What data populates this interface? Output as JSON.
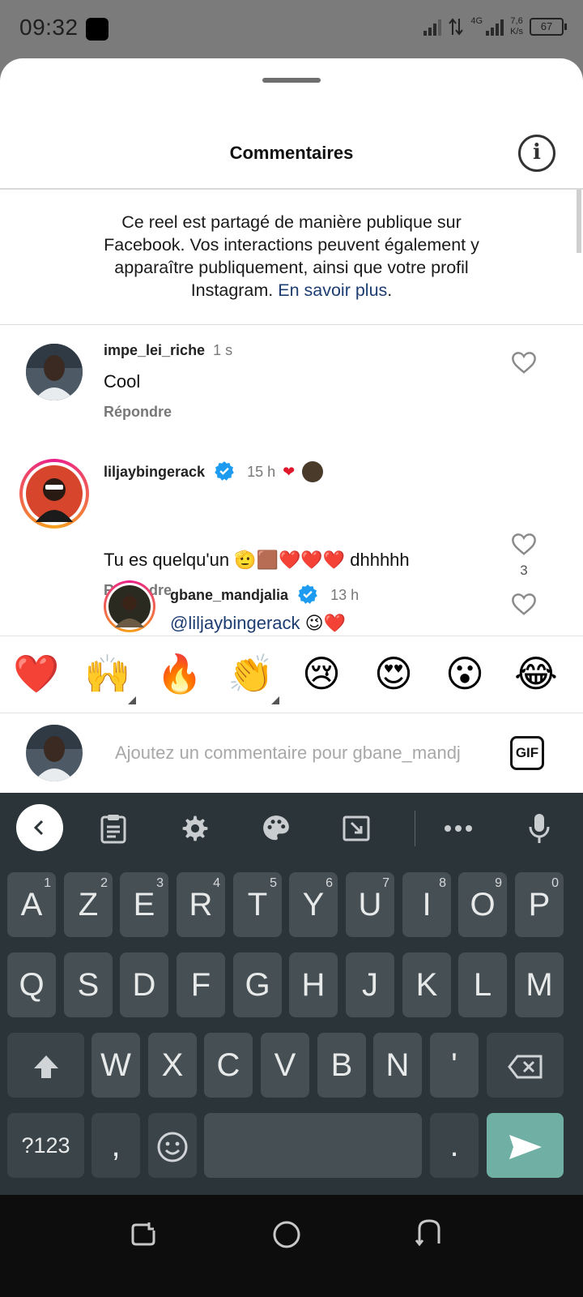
{
  "status_bar": {
    "time": "09:32",
    "network": "4G",
    "speed_value": "7,6",
    "speed_unit": "K/s",
    "battery": "67"
  },
  "sheet": {
    "title": "Commentaires",
    "info_icon": "info-icon",
    "notice_text": "Ce reel est partagé de manière publique sur Facebook. Vos interactions peuvent également y apparaître publiquement, ainsi que votre profil Instagram. ",
    "notice_link": "En savoir plus",
    "notice_end": "."
  },
  "comments": [
    {
      "username": "impe_lei_riche",
      "time": "1 s",
      "text": "Cool",
      "reply": "Répondre",
      "likes": ""
    },
    {
      "username": "liljaybingerack",
      "verified": true,
      "time": "15 h",
      "text": "Tu es quelqu'un 🫡🟫❤️❤️❤️ dhhhhh",
      "reply": "Répondre",
      "likes": "3"
    },
    {
      "username": "gbane_mandjalia",
      "verified": true,
      "time": "13 h",
      "mention": "@liljaybingerack",
      "text": " 😉❤️"
    }
  ],
  "reactions": [
    "❤️",
    "🙌",
    "🔥",
    "👏",
    "😢",
    "😍",
    "😮",
    "😂"
  ],
  "composer": {
    "placeholder": "Ajoutez un commentaire pour gbane_mandj",
    "gif_label": "GIF"
  },
  "keyboard": {
    "toolbar_icons": [
      "back-icon",
      "clipboard-icon",
      "settings-icon",
      "palette-icon",
      "resize-icon",
      "more-icon",
      "microphone-icon"
    ],
    "row1": [
      {
        "k": "A",
        "n": "1"
      },
      {
        "k": "Z",
        "n": "2"
      },
      {
        "k": "E",
        "n": "3"
      },
      {
        "k": "R",
        "n": "4"
      },
      {
        "k": "T",
        "n": "5"
      },
      {
        "k": "Y",
        "n": "6"
      },
      {
        "k": "U",
        "n": "7"
      },
      {
        "k": "I",
        "n": "8"
      },
      {
        "k": "O",
        "n": "9"
      },
      {
        "k": "P",
        "n": "0"
      }
    ],
    "row2": [
      "Q",
      "S",
      "D",
      "F",
      "G",
      "H",
      "J",
      "K",
      "L",
      "M"
    ],
    "row3": [
      "W",
      "X",
      "C",
      "V",
      "B",
      "N",
      "'"
    ],
    "symbols_label": "?123",
    "comma": ",",
    "period": "."
  },
  "colors": {
    "link": "#1d3d72",
    "keyboard_bg": "#2b3439",
    "key_bg": "#454f54",
    "enter_key": "#6fafa4",
    "verified": "#1d9bf0"
  }
}
